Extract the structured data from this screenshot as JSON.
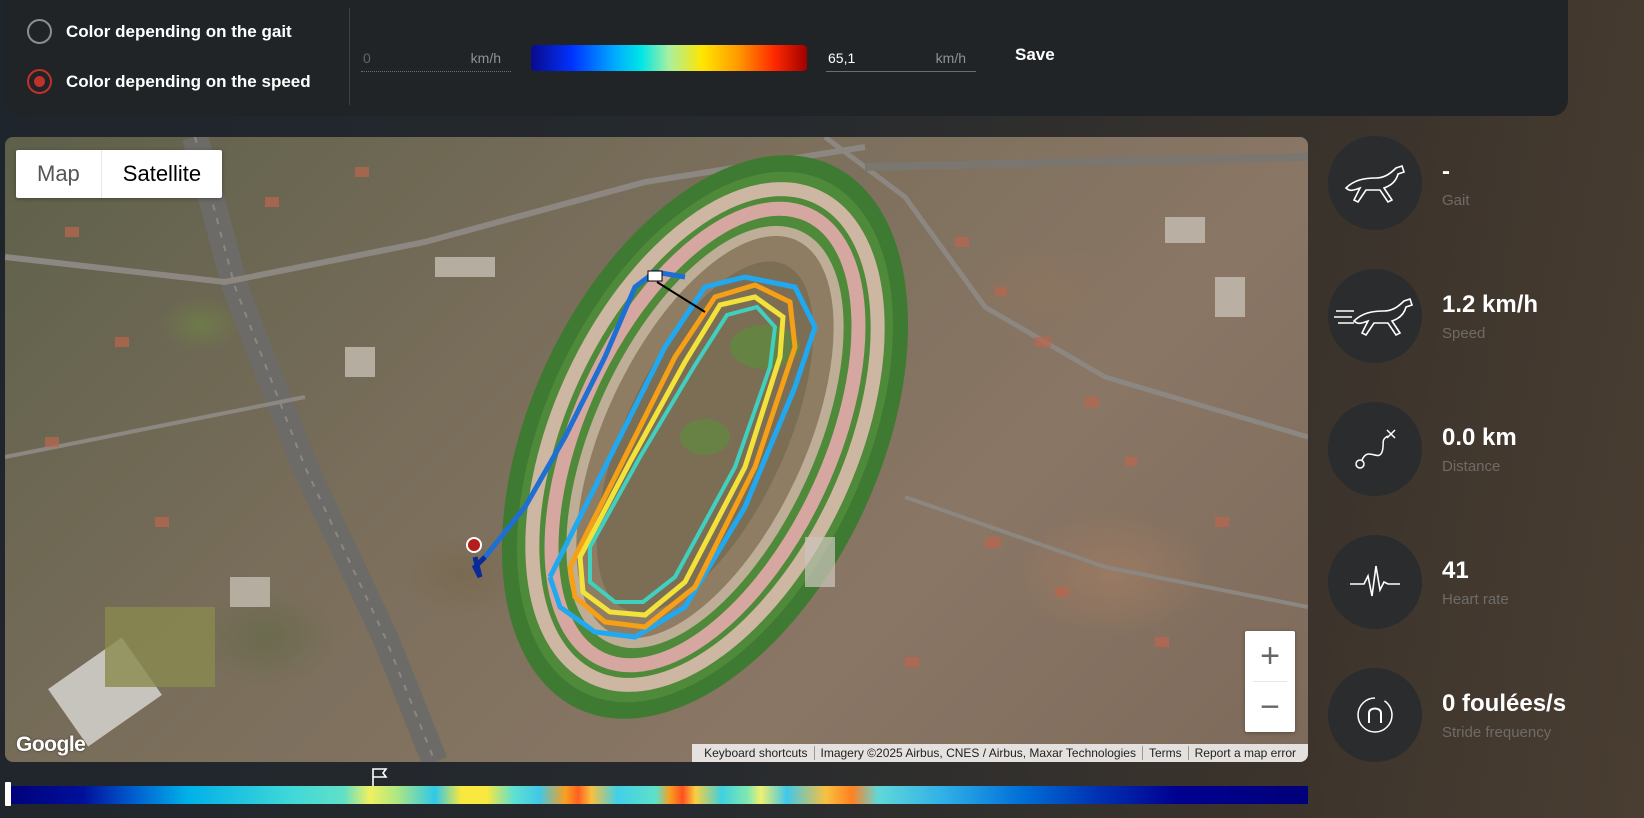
{
  "controls": {
    "radio_gait": "Color depending on the gait",
    "radio_speed": "Color depending on the speed",
    "selected": "speed",
    "min_value": "0",
    "min_unit": "km/h",
    "max_value": "65,1",
    "max_unit": "km/h",
    "save_label": "Save"
  },
  "map": {
    "type_map": "Map",
    "type_satellite": "Satellite",
    "active_type": "Satellite",
    "zoom_in": "+",
    "zoom_out": "−",
    "logo": "Google",
    "attribution": {
      "shortcuts": "Keyboard shortcuts",
      "imagery": "Imagery ©2025 Airbus, CNES / Airbus, Maxar Technologies",
      "terms": "Terms",
      "report": "Report a map error"
    }
  },
  "stats": [
    {
      "icon": "horse-gait-icon",
      "value": "-",
      "label": "Gait"
    },
    {
      "icon": "horse-speed-icon",
      "value": "1.2 km/h",
      "label": "Speed"
    },
    {
      "icon": "distance-route-icon",
      "value": "0.0 km",
      "label": "Distance"
    },
    {
      "icon": "heart-rate-icon",
      "value": "41",
      "label": "Heart rate"
    },
    {
      "icon": "horseshoe-stride-icon",
      "value": "0 foulées/s",
      "label": "Stride frequency"
    }
  ],
  "colors": {
    "accent_red": "#c0312b",
    "panel_bg": "#202427"
  }
}
